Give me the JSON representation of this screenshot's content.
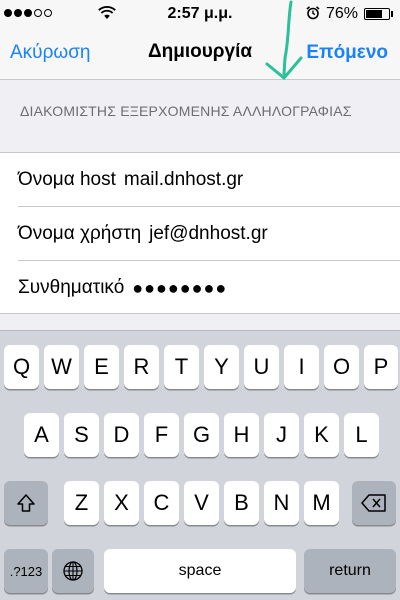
{
  "status_bar": {
    "signal_dots_filled": 3,
    "signal_dots_total": 5,
    "time": "2:57 μ.μ.",
    "battery_percent_text": "76%",
    "battery_level": 0.76,
    "icons": [
      "wifi-icon",
      "alarm-icon",
      "battery-icon"
    ]
  },
  "nav": {
    "cancel_label": "Ακύρωση",
    "title": "Δημιουργία",
    "next_label": "Επόμενο",
    "accent_color": "#1a82fb",
    "annotation_color": "#2bbf9a"
  },
  "section": {
    "header": "ΔΙΑΚΟΜΙΣΤΗΣ ΕΞΕΡΧΟΜΕΝΗΣ ΑΛΛΗΛΟΓΡΑΦΙΑΣ"
  },
  "fields": [
    {
      "label": "Όνομα host",
      "value": "mail.dnhost.gr"
    },
    {
      "label": "Όνομα χρήστη",
      "value": "jef@dnhost.gr"
    },
    {
      "label": "Συνθηματικό",
      "value": "●●●●●●●●"
    }
  ],
  "keyboard": {
    "row1": [
      "Q",
      "W",
      "E",
      "R",
      "T",
      "Y",
      "U",
      "I",
      "O",
      "P"
    ],
    "row2": [
      "A",
      "S",
      "D",
      "F",
      "G",
      "H",
      "J",
      "K",
      "L"
    ],
    "row3": [
      "Z",
      "X",
      "C",
      "V",
      "B",
      "N",
      "M"
    ],
    "numbers_label": ".?123",
    "space_label": "space",
    "return_label": "return"
  }
}
